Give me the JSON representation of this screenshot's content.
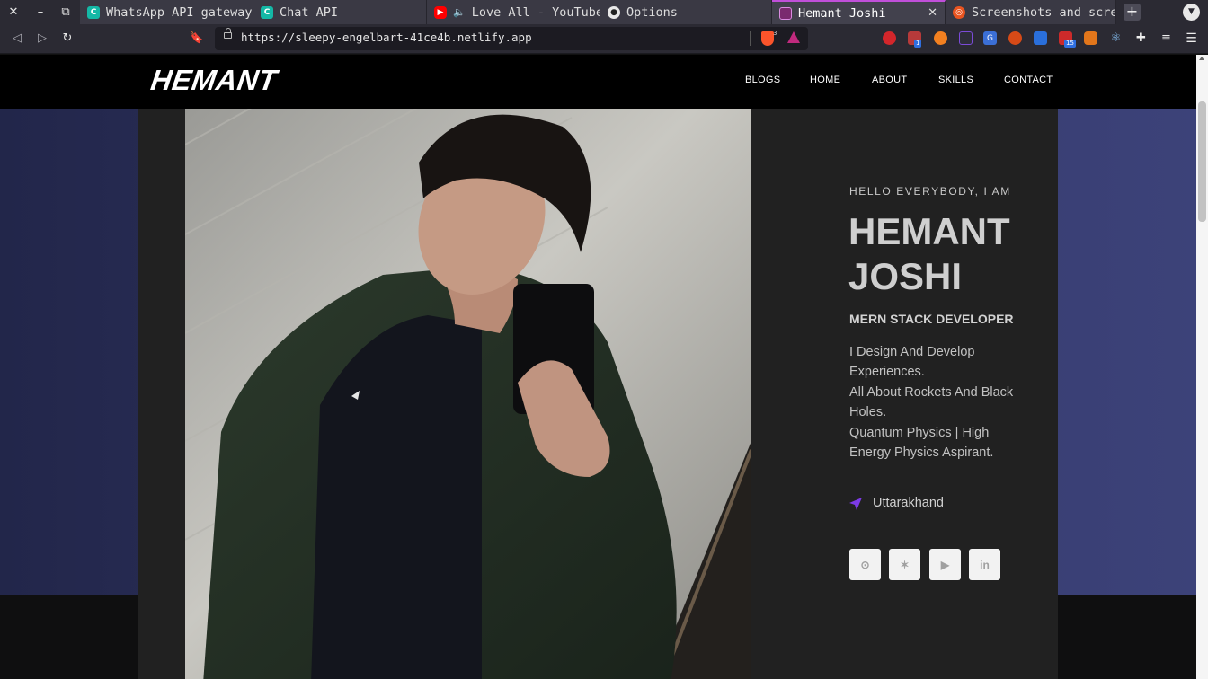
{
  "browser": {
    "tabs": [
      {
        "label": "WhatsApp API gateway",
        "favicon": "chat-api-favicon"
      },
      {
        "label": "Chat API",
        "favicon": "chat-api-favicon"
      },
      {
        "label": "Love All - YouTube",
        "favicon": "youtube-favicon"
      },
      {
        "label": "Options",
        "favicon": "github-favicon"
      },
      {
        "label": "Hemant Joshi",
        "favicon": "site-favicon",
        "active": true
      },
      {
        "label": "Screenshots and screenshots",
        "favicon": "ubuntu-favicon"
      }
    ],
    "url": "https://sleepy-engelbart-41ce4b.netlify.app",
    "shield_count": "3",
    "extension_badges": {
      "first": "1",
      "second": "15"
    }
  },
  "site": {
    "logo": "HEMANT",
    "nav": [
      "BLOGS",
      "HOME",
      "ABOUT",
      "SKILLS",
      "CONTACT"
    ],
    "hero": {
      "greeting": "HELLO EVERYBODY, I AM",
      "name_line1": "HEMANT",
      "name_line2": "JOSHI",
      "role": "MERN STACK DEVELOPER",
      "bio": [
        "I Design And Develop",
        "Experiences.",
        "All About Rockets And Black",
        "Holes.",
        "Quantum Physics | High",
        "Energy Physics Aspirant."
      ],
      "location": "Uttarakhand",
      "social": [
        {
          "name": "github-icon",
          "glyph": "⊙"
        },
        {
          "name": "twitter-icon",
          "glyph": "✶"
        },
        {
          "name": "youtube-icon",
          "glyph": "▶"
        },
        {
          "name": "linkedin-icon",
          "glyph": "in"
        }
      ]
    }
  },
  "colors": {
    "accent": "#7c3ae6",
    "hero_bg": "#353a6c",
    "card_bg": "#212121",
    "nav_bg": "#000000"
  }
}
